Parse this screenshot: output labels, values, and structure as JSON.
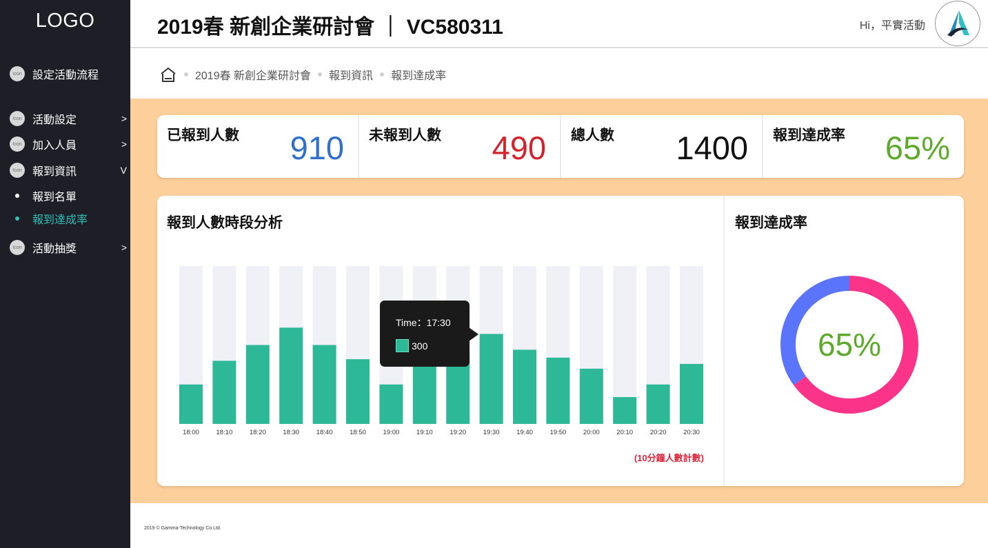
{
  "sidebar": {
    "logo": "LOGO",
    "icon_text": "Icon",
    "items": [
      {
        "label": "設定活動流程",
        "arrow": ""
      },
      {
        "label": "活動設定",
        "arrow": ">"
      },
      {
        "label": "加入人員",
        "arrow": ">"
      },
      {
        "label": "報到資訊",
        "arrow": "V"
      },
      {
        "label": "活動抽獎",
        "arrow": ">"
      }
    ],
    "sub_items": [
      {
        "label": "報到名單",
        "active": false
      },
      {
        "label": "報到達成率",
        "active": true
      }
    ]
  },
  "header": {
    "title": "2019春 新創企業研討會 ｜ VC580311",
    "greeting": "Hi，平實活動"
  },
  "breadcrumb": [
    "2019春 新創企業研討會",
    "報到資訊",
    "報到達成率"
  ],
  "stats": [
    {
      "label": "已報到人數",
      "value": "910",
      "color": "#2f6fcd"
    },
    {
      "label": "未報到人數",
      "value": "490",
      "color": "#d3232d"
    },
    {
      "label": "總人數",
      "value": "1400",
      "color": "#111111"
    },
    {
      "label": "報到達成率",
      "value": "65%",
      "color": "#5ca92b"
    }
  ],
  "bar_panel": {
    "title": "報到人數時段分析",
    "note": "(10分鐘人數計數)",
    "tooltip": {
      "time": "Time：17:30",
      "value": "300"
    }
  },
  "donut_panel": {
    "title": "報到達成率",
    "center_label": "65%"
  },
  "chart_data": [
    {
      "type": "bar",
      "title": "報到人數時段分析",
      "categories": [
        "18:00",
        "18:10",
        "18:20",
        "18:30",
        "18:40",
        "18:50",
        "19:00",
        "19:10",
        "19:20",
        "19:30",
        "19:40",
        "19:50",
        "20:00",
        "20:10",
        "20:20",
        "20:30"
      ],
      "values": [
        0.25,
        0.4,
        0.5,
        0.61,
        0.5,
        0.41,
        0.25,
        0.4,
        0.45,
        0.57,
        0.47,
        0.42,
        0.35,
        0.17,
        0.25,
        0.38
      ],
      "value_unit": "fraction of column height (axis not labeled)",
      "colors": {
        "bar": "#2db898",
        "track": "#f0f0f7"
      },
      "grid": false
    },
    {
      "type": "pie",
      "title": "報到達成率",
      "donut": true,
      "slices": [
        {
          "value": 65,
          "color": "#fb3389"
        },
        {
          "value": 35,
          "color": "#5a74fb"
        }
      ],
      "center_label": "65%"
    }
  ],
  "footer": "2019 ©  Gamma-Technology Co.Ltd."
}
